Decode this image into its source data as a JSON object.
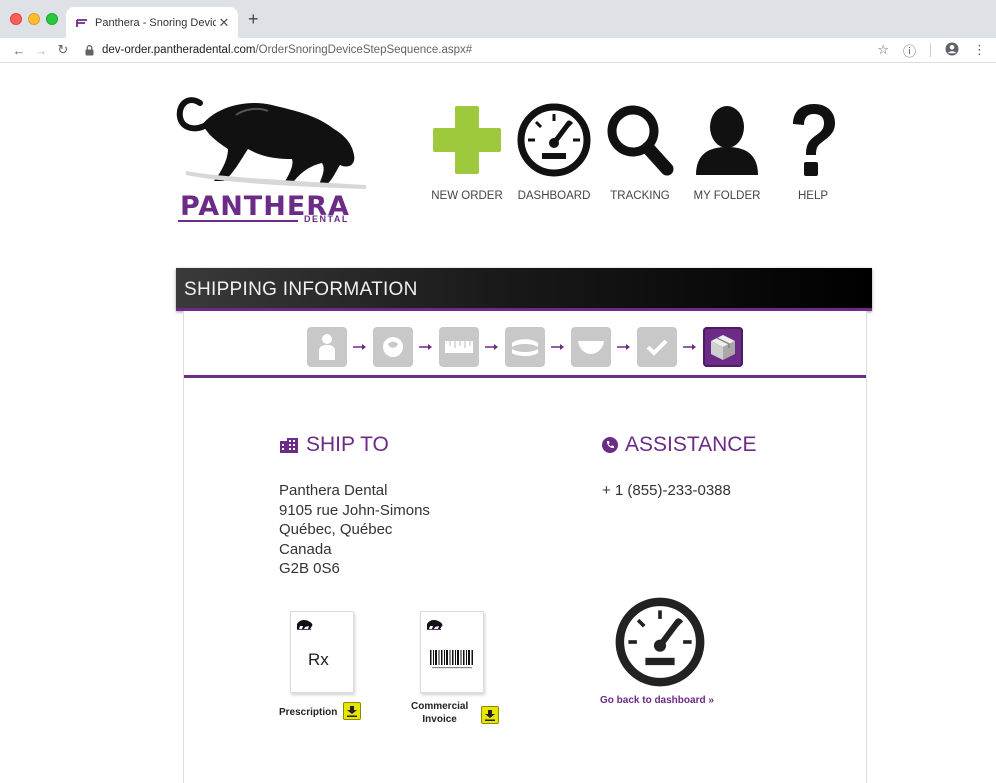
{
  "browser": {
    "tab_title": "Panthera - Snoring Device Order",
    "url_domain": "dev-order.pantheradental.com",
    "url_path": "/OrderSnoringDeviceStepSequence.aspx#"
  },
  "brand": {
    "name": "PANTHERA",
    "sub": "DENTAL",
    "color": "#6b2b86"
  },
  "nav": {
    "new_order": "NEW ORDER",
    "dashboard": "DASHBOARD",
    "tracking": "TRACKING",
    "my_folder": "MY FOLDER",
    "help": "HELP"
  },
  "panel": {
    "title": "SHIPPING INFORMATION"
  },
  "steps": [
    {
      "icon": "patient-icon",
      "active": false
    },
    {
      "icon": "arch-icon",
      "active": false
    },
    {
      "icon": "measurement-icon",
      "active": false
    },
    {
      "icon": "device-icon",
      "active": false
    },
    {
      "icon": "tray-icon",
      "active": false
    },
    {
      "icon": "check-icon",
      "active": false
    },
    {
      "icon": "package-icon",
      "active": true
    }
  ],
  "ship_to": {
    "title": "SHIP TO",
    "line1": "Panthera Dental",
    "line2": "9105 rue John-Simons",
    "line3": "Québec, Québec",
    "line4": "Canada",
    "line5": "G2B 0S6"
  },
  "assistance": {
    "title": "ASSISTANCE",
    "phone": "+ 1 (855)-233-0388"
  },
  "documents": {
    "prescription_label": "Prescription",
    "prescription_mark": "Rx",
    "invoice_label_1": "Commercial",
    "invoice_label_2": "Invoice"
  },
  "back_link": "Go back to dashboard »",
  "colors": {
    "accent": "#6b2b86",
    "new_order_plus": "#9fc93c",
    "download": "#e8e600"
  }
}
